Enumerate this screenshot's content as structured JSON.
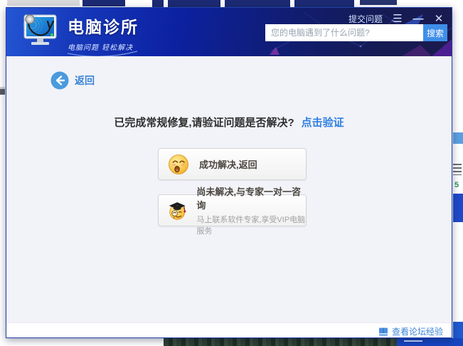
{
  "window": {
    "brand": {
      "title": "电脑诊所",
      "subtitle": "电脑问题 轻松解决"
    },
    "topbar": {
      "submit_link": "提交问题",
      "menu_glyph": "☰",
      "minimize_glyph": "—",
      "close_glyph": "✕"
    },
    "search": {
      "placeholder": "您的电脑遇到了什么问题?",
      "button": "搜索"
    },
    "back_label": "返回",
    "message": {
      "text": "已完成常规修复,请验证问题是否解决?",
      "link": "点击验证"
    },
    "options": [
      {
        "icon": "relieved-emoji",
        "title": "成功解决,返回",
        "subtitle": ""
      },
      {
        "icon": "expert-emoji",
        "title": "尚未解决,与专家一对一咨询",
        "subtitle": "马上联系软件专家,享受VIP电脑服务"
      }
    ],
    "footer": {
      "forum_link": "查看论坛经验"
    }
  },
  "background": {
    "right_number": "5"
  },
  "colors": {
    "header_blue": "#0c21a2",
    "accent_blue": "#3f8ee8",
    "link_blue": "#2f7fe0",
    "content_bg": "#f2f3f8"
  }
}
